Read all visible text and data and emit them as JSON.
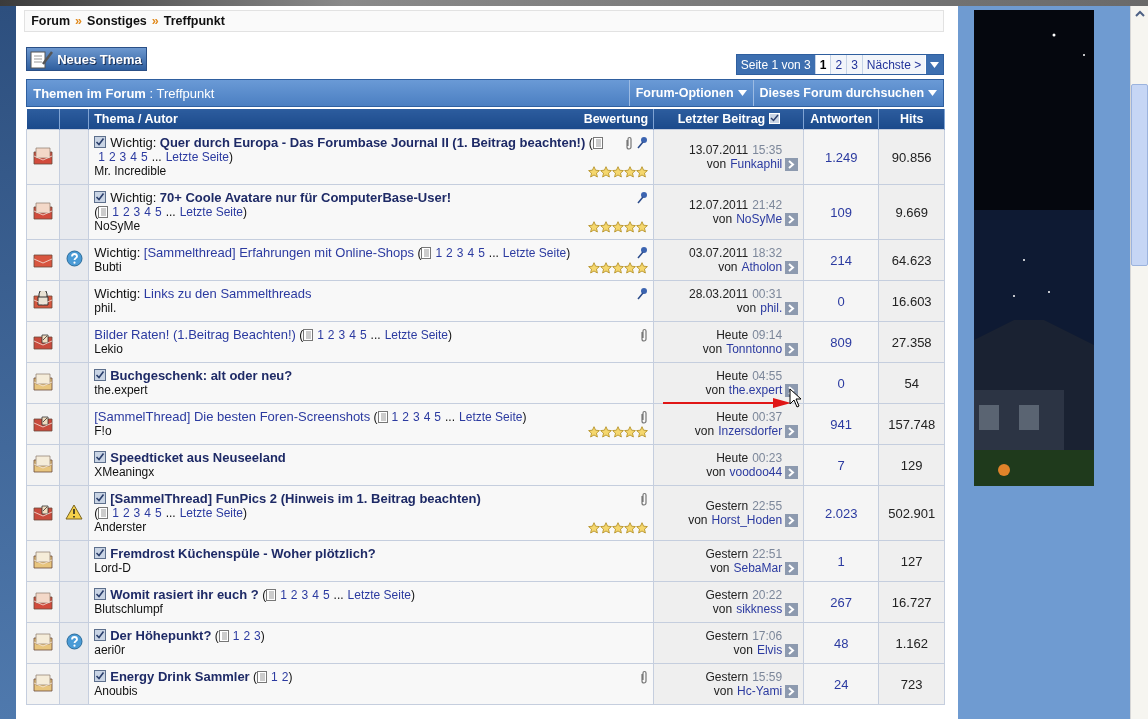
{
  "breadcrumb": {
    "items": [
      "Forum",
      "Sonstiges",
      "Treffpunkt"
    ],
    "separator": "»"
  },
  "new_thread_button": "Neues Thema",
  "pagination": {
    "label": "Seite 1 von 3",
    "pages": [
      {
        "label": "1",
        "selected": true
      },
      {
        "label": "2",
        "selected": false
      },
      {
        "label": "3",
        "selected": false
      }
    ],
    "next": "Nächste >"
  },
  "forum_bar": {
    "title": "**Themen im Forum** : Treffpunkt",
    "menus": [
      "Forum-Optionen",
      "Dieses Forum durchsuchen"
    ]
  },
  "columns": {
    "thread": "Thema / Autor",
    "rating": "Bewertung",
    "last_post": "Letzter Beitrag",
    "replies": "Antworten",
    "hits": "Hits"
  },
  "rows": [
    {
      "status": {
        "kind": "hot"
      },
      "tick": true,
      "prefix": "Wichtig:",
      "title": "Quer durch Europa - Das Forumbase Journal II (1. Beitrag beachten!)",
      "bold": true,
      "pager": {
        "open": "(",
        "pages": [
          "1",
          "2",
          "3",
          "4",
          "5"
        ],
        "ellipsis": "...",
        "last": "Letzte Seite",
        "close": ")"
      },
      "author": "Mr. Incredible",
      "attachment": true,
      "sticky": true,
      "stars": 5,
      "last_post": {
        "date": "13.07.2011",
        "time": "15:35",
        "by": "von",
        "user": "Funkaphil"
      },
      "replies": "1.249",
      "hits": "90.856"
    },
    {
      "status": {
        "kind": "hot"
      },
      "tick": true,
      "prefix": "Wichtig:",
      "title": "70+ Coole Avatare nur für ComputerBase-User!",
      "bold": true,
      "pager": {
        "open": "(",
        "pages": [
          "1",
          "2",
          "3",
          "4",
          "5"
        ],
        "ellipsis": "...",
        "last": "Letzte Seite",
        "close": ")"
      },
      "pager_break": true,
      "author": "NoSyMe",
      "attachment": false,
      "sticky": true,
      "stars": 5,
      "last_post": {
        "date": "12.07.2011",
        "time": "21:42",
        "by": "von",
        "user": "NoSyMe"
      },
      "replies": "109",
      "hits": "9.669"
    },
    {
      "status": {
        "kind": "closed"
      },
      "post_icon": {
        "kind": "question"
      },
      "tick": false,
      "prefix": "Wichtig:",
      "title": "[Sammelthread] Erfahrungen mit Online-Shops",
      "bold": false,
      "pager": {
        "open": "(",
        "pages": [
          "1",
          "2",
          "3",
          "4",
          "5"
        ],
        "ellipsis": "...",
        "last": "Letzte Seite",
        "close": ")"
      },
      "pager_break": false,
      "author": "Bubti",
      "attachment": false,
      "sticky": true,
      "stars": 5,
      "last_post": {
        "date": "03.07.2011",
        "time": "18:32",
        "by": "von",
        "user": "Atholon"
      },
      "replies": "214",
      "hits": "64.623"
    },
    {
      "status": {
        "kind": "locked"
      },
      "tick": false,
      "prefix": "Wichtig:",
      "title": "Links zu den Sammelthreads",
      "bold": false,
      "author": "phil.",
      "attachment": false,
      "sticky": true,
      "last_post": {
        "date": "28.03.2011",
        "time": "00:31",
        "by": "von",
        "user": "phil."
      },
      "replies": "0",
      "hits": "16.603"
    },
    {
      "status": {
        "kind": "moved"
      },
      "tick": false,
      "title": "Bilder Raten! (1.Beitrag Beachten!)",
      "bold": false,
      "pager": {
        "open": "(",
        "pages": [
          "1",
          "2",
          "3",
          "4",
          "5"
        ],
        "ellipsis": "...",
        "last": "Letzte Seite",
        "close": ")"
      },
      "pager_break": false,
      "author": "Lekio",
      "attachment": true,
      "sticky": false,
      "last_post": {
        "date": "Heute",
        "time": "09:14",
        "by": "von",
        "user": "Tonntonno"
      },
      "replies": "809",
      "hits": "27.358"
    },
    {
      "status": {
        "kind": "normal"
      },
      "tick": true,
      "title": "Buchgeschenk: alt oder neu?",
      "bold": true,
      "author": "the.expert",
      "attachment": false,
      "sticky": false,
      "last_post": {
        "date": "Heute",
        "time": "04:55",
        "by": "von",
        "user": "the.expert"
      },
      "replies": "0",
      "hits": "54"
    },
    {
      "status": {
        "kind": "moved"
      },
      "tick": false,
      "title": "[SammelThread] Die besten Foren-Screenshots",
      "bold": false,
      "pager": {
        "open": "(",
        "pages": [
          "1",
          "2",
          "3",
          "4",
          "5"
        ],
        "ellipsis": "...",
        "last": "Letzte Seite",
        "close": ")"
      },
      "pager_break": false,
      "author": "F!o",
      "attachment": true,
      "sticky": false,
      "stars": 5,
      "last_post": {
        "date": "Heute",
        "time": "00:37",
        "by": "von",
        "user": "Inzersdorfer"
      },
      "replies": "941",
      "hits": "157.748"
    },
    {
      "status": {
        "kind": "normal"
      },
      "tick": true,
      "title": "Speedticket aus Neuseeland",
      "bold": true,
      "author": "XMeaningx",
      "attachment": false,
      "sticky": false,
      "last_post": {
        "date": "Heute",
        "time": "00:23",
        "by": "von",
        "user": "voodoo44"
      },
      "replies": "7",
      "hits": "129"
    },
    {
      "status": {
        "kind": "moved"
      },
      "post_icon": {
        "kind": "warning"
      },
      "tick": true,
      "title": "[SammelThread] FunPics 2 (Hinweis im 1. Beitrag beachten)",
      "bold": true,
      "pager": {
        "open": "(",
        "pages": [
          "1",
          "2",
          "3",
          "4",
          "5"
        ],
        "ellipsis": "...",
        "last": "Letzte Seite",
        "close": ")"
      },
      "pager_break": true,
      "author": "Anderster",
      "attachment": true,
      "sticky": false,
      "stars": 5,
      "last_post": {
        "date": "Gestern",
        "time": "22:55",
        "by": "von",
        "user": "Horst_Hoden"
      },
      "replies": "2.023",
      "hits": "502.901"
    },
    {
      "status": {
        "kind": "normal"
      },
      "tick": true,
      "title": "Fremdrost Küchenspüle - Woher plötzlich?",
      "bold": true,
      "author": "Lord-D",
      "attachment": false,
      "sticky": false,
      "last_post": {
        "date": "Gestern",
        "time": "22:51",
        "by": "von",
        "user": "SebaMar"
      },
      "replies": "1",
      "hits": "127"
    },
    {
      "status": {
        "kind": "hot"
      },
      "tick": true,
      "title": "Womit rasiert ihr euch ?",
      "bold": true,
      "pager": {
        "open": "(",
        "pages": [
          "1",
          "2",
          "3",
          "4",
          "5"
        ],
        "ellipsis": "...",
        "last": "Letzte Seite",
        "close": ")"
      },
      "pager_break": false,
      "author": "Blutschlumpf",
      "attachment": false,
      "sticky": false,
      "last_post": {
        "date": "Gestern",
        "time": "20:22",
        "by": "von",
        "user": "sikkness"
      },
      "replies": "267",
      "hits": "16.727"
    },
    {
      "status": {
        "kind": "normal"
      },
      "post_icon": {
        "kind": "question"
      },
      "tick": true,
      "title": "Der Höhepunkt?",
      "bold": true,
      "pager": {
        "open": "(",
        "pages": [
          "1",
          "2",
          "3"
        ],
        "close": ")"
      },
      "pager_break": false,
      "author": "aeri0r",
      "attachment": false,
      "sticky": false,
      "last_post": {
        "date": "Gestern",
        "time": "17:06",
        "by": "von",
        "user": "Elvis"
      },
      "replies": "48",
      "hits": "1.162"
    },
    {
      "status": {
        "kind": "normal"
      },
      "tick": true,
      "title": "Energy Drink Sammler",
      "bold": true,
      "pager": {
        "open": "(",
        "pages": [
          "1",
          "2"
        ],
        "close": ")"
      },
      "pager_break": false,
      "author": "Anoubis",
      "attachment": true,
      "sticky": false,
      "last_post": {
        "date": "Gestern",
        "time": "15:59",
        "by": "von",
        "user": "Hc-Yami"
      },
      "replies": "24",
      "hits": "723"
    }
  ]
}
